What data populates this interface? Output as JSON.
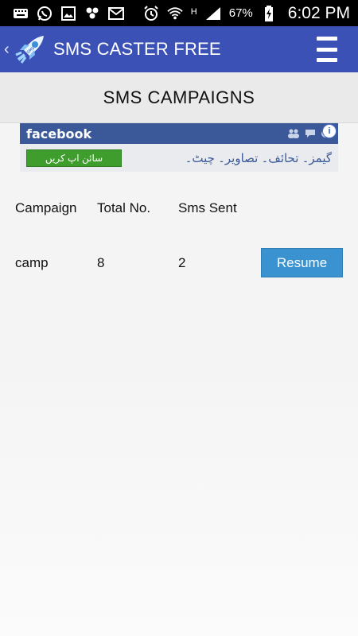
{
  "status_bar": {
    "battery_percent": "67%",
    "network_label": "H",
    "time": "6:02 PM"
  },
  "app_bar": {
    "title": "SMS CASTER FREE"
  },
  "section": {
    "title": "SMS CAMPAIGNS"
  },
  "ad": {
    "brand": "facebook",
    "button_label": "سائن اپ کریں",
    "tagline": "گیمز۔ تحائف۔ تصاویر۔ چیٹ۔"
  },
  "table": {
    "headers": [
      "Campaign",
      "Total No.",
      "Sms Sent"
    ],
    "rows": [
      {
        "campaign": "camp",
        "total": "8",
        "sent": "2",
        "action_label": "Resume"
      }
    ]
  },
  "colors": {
    "app_bar": "#3c51b6",
    "section_header": "#eaeaea",
    "resume_button": "#3a93d0",
    "facebook_blue": "#3b5998",
    "ad_button": "#3f9d2e"
  }
}
